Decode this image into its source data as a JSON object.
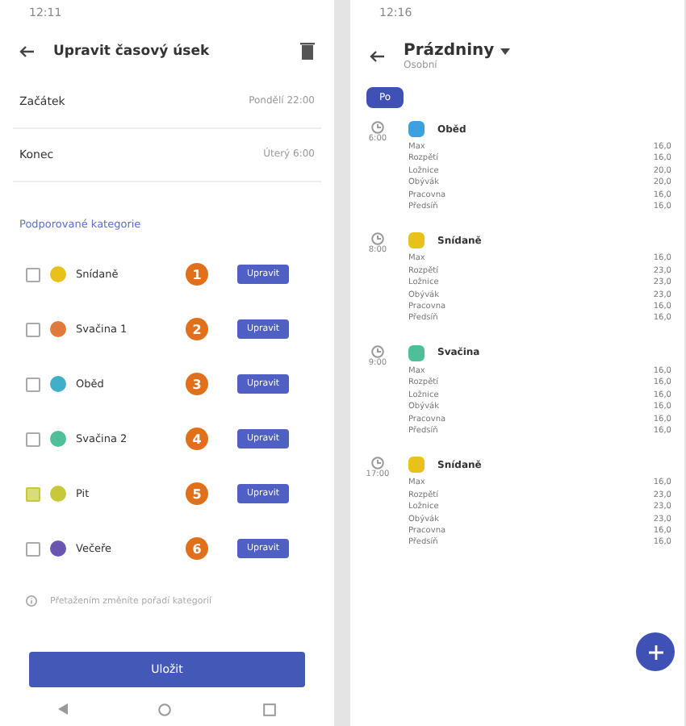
{
  "left": {
    "status_time": "12:11",
    "title": "Upravit časový úsek",
    "fields": [
      {
        "label": "Začátek",
        "value": "Pondělí 22:00"
      },
      {
        "label": "Konec",
        "value": "Úterý 6:00"
      }
    ],
    "section_label": "Podporované kategorie",
    "categories": [
      {
        "name": "Snídaně",
        "color": "#e8c21a",
        "checked": false,
        "number": "1",
        "button": "Upravit"
      },
      {
        "name": "Svačina 1",
        "color": "#e07a3a",
        "checked": false,
        "number": "2",
        "button": "Upravit"
      },
      {
        "name": "Oběd",
        "color": "#3fb0c8",
        "checked": false,
        "number": "3",
        "button": "Upravit"
      },
      {
        "name": "Svačina 2",
        "color": "#4fbf9a",
        "checked": false,
        "number": "4",
        "button": "Upravit"
      },
      {
        "name": "Pit",
        "color": "#c7c93a",
        "checked": true,
        "number": "5",
        "button": "Upravit"
      },
      {
        "name": "Večeře",
        "color": "#6a55b0",
        "checked": false,
        "number": "6",
        "button": "Upravit"
      }
    ],
    "hint": "Přetažením změníte pořadí kategorií",
    "save": "Uložit"
  },
  "right": {
    "status_time": "12:16",
    "title": "Prázdniny",
    "subtitle": "Osobní",
    "chips": [
      {
        "label": "Po",
        "selected": true
      }
    ],
    "sections": [
      {
        "time": "6:00",
        "name": "Oběd",
        "color": "#3fa0e0",
        "rows": [
          {
            "label": "Max",
            "value": "16,0"
          },
          {
            "label": "Rozpětí",
            "value": "16,0"
          },
          {
            "label": "Ložnice",
            "value": "20,0"
          },
          {
            "label": "Obývák",
            "value": "20,0"
          },
          {
            "label": "Pracovna",
            "value": "16,0"
          },
          {
            "label": "Předsíň",
            "value": "16,0"
          }
        ]
      },
      {
        "time": "8:00",
        "name": "Snídaně",
        "color": "#e8c21a",
        "rows": [
          {
            "label": "Max",
            "value": "16,0"
          },
          {
            "label": "Rozpětí",
            "value": "23,0"
          },
          {
            "label": "Ložnice",
            "value": "23,0"
          },
          {
            "label": "Obývák",
            "value": "23,0"
          },
          {
            "label": "Pracovna",
            "value": "16,0"
          },
          {
            "label": "Předsíň",
            "value": "16,0"
          }
        ]
      },
      {
        "time": "9:00",
        "name": "Svačina",
        "color": "#4fbf9a",
        "rows": [
          {
            "label": "Max",
            "value": "16,0"
          },
          {
            "label": "Rozpětí",
            "value": "16,0"
          },
          {
            "label": "Ložnice",
            "value": "16,0"
          },
          {
            "label": "Obývák",
            "value": "16,0"
          },
          {
            "label": "Pracovna",
            "value": "16,0"
          },
          {
            "label": "Předsíň",
            "value": "16,0"
          }
        ]
      },
      {
        "time": "17:00",
        "name": "Snídaně",
        "color": "#e8c21a",
        "rows": [
          {
            "label": "Max",
            "value": "16,0"
          },
          {
            "label": "Rozpětí",
            "value": "23,0"
          },
          {
            "label": "Ložnice",
            "value": "23,0"
          },
          {
            "label": "Obývák",
            "value": "23,0"
          },
          {
            "label": "Pracovna",
            "value": "16,0"
          },
          {
            "label": "Předsíň",
            "value": "16,0"
          }
        ]
      }
    ]
  }
}
